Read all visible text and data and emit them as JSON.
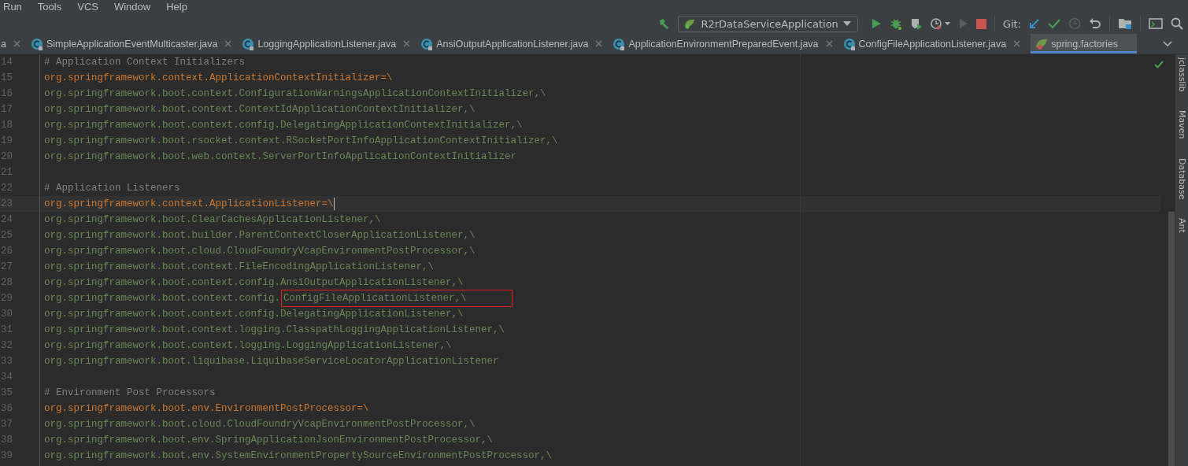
{
  "menu": [
    "Run",
    "Tools",
    "VCS",
    "Window",
    "Help"
  ],
  "toolbar": {
    "run_config": "R2rDataServiceApplication",
    "git_label": "Git:"
  },
  "tabs": [
    {
      "label": "a",
      "selected": false
    },
    {
      "label": "SimpleApplicationEventMulticaster.java",
      "kind": "java",
      "selected": false
    },
    {
      "label": "LoggingApplicationListener.java",
      "kind": "java",
      "selected": false
    },
    {
      "label": "AnsiOutputApplicationListener.java",
      "kind": "java",
      "selected": false
    },
    {
      "label": "ApplicationEnvironmentPreparedEvent.java",
      "kind": "java",
      "selected": false
    },
    {
      "label": "ConfigFileApplicationListener.java",
      "kind": "java",
      "selected": false
    },
    {
      "label": "spring.factories",
      "kind": "spring",
      "selected": true
    }
  ],
  "lines": [
    {
      "number": "14",
      "kind": "comment",
      "text": "# Application Context Initializers"
    },
    {
      "number": "15",
      "kind": "key",
      "text": "org.springframework.context.ApplicationContextInitializer=\\"
    },
    {
      "number": "16",
      "kind": "value",
      "text": "org.springframework.boot.context.ConfigurationWarningsApplicationContextInitializer,\\"
    },
    {
      "number": "17",
      "kind": "value",
      "text": "org.springframework.boot.context.ContextIdApplicationContextInitializer,\\"
    },
    {
      "number": "18",
      "kind": "value",
      "text": "org.springframework.boot.context.config.DelegatingApplicationContextInitializer,\\"
    },
    {
      "number": "19",
      "kind": "value",
      "text": "org.springframework.boot.rsocket.context.RSocketPortInfoApplicationContextInitializer,\\"
    },
    {
      "number": "20",
      "kind": "value",
      "text": "org.springframework.boot.web.context.ServerPortInfoApplicationContextInitializer"
    },
    {
      "number": "21",
      "kind": "blank"
    },
    {
      "number": "22",
      "kind": "comment",
      "text": "# Application Listeners"
    },
    {
      "number": "23",
      "kind": "key",
      "text": "org.springframework.context.ApplicationListener=\\",
      "current": true
    },
    {
      "number": "24",
      "kind": "value",
      "text": "org.springframework.boot.ClearCachesApplicationListener,\\"
    },
    {
      "number": "25",
      "kind": "value",
      "text": "org.springframework.boot.builder.ParentContextCloserApplicationListener,\\"
    },
    {
      "number": "26",
      "kind": "value",
      "text": "org.springframework.boot.cloud.CloudFoundryVcapEnvironmentPostProcessor,\\"
    },
    {
      "number": "27",
      "kind": "value",
      "text": "org.springframework.boot.context.FileEncodingApplicationListener,\\"
    },
    {
      "number": "28",
      "kind": "value",
      "text": "org.springframework.boot.context.config.AnsiOutputApplicationListener,\\"
    },
    {
      "number": "29",
      "kind": "value",
      "text": "org.springframework.boot.context.config.",
      "boxed_text": "ConfigFileApplicationListener,\\"
    },
    {
      "number": "30",
      "kind": "value",
      "text": "org.springframework.boot.context.config.DelegatingApplicationListener,\\"
    },
    {
      "number": "31",
      "kind": "value",
      "text": "org.springframework.boot.context.logging.ClasspathLoggingApplicationListener,\\"
    },
    {
      "number": "32",
      "kind": "value",
      "text": "org.springframework.boot.context.logging.LoggingApplicationListener,\\"
    },
    {
      "number": "33",
      "kind": "value",
      "text": "org.springframework.boot.liquibase.LiquibaseServiceLocatorApplicationListener"
    },
    {
      "number": "34",
      "kind": "blank"
    },
    {
      "number": "35",
      "kind": "comment",
      "text": "# Environment Post Processors"
    },
    {
      "number": "36",
      "kind": "key",
      "text": "org.springframework.boot.env.EnvironmentPostProcessor=\\"
    },
    {
      "number": "37",
      "kind": "value",
      "text": "org.springframework.boot.cloud.CloudFoundryVcapEnvironmentPostProcessor,\\"
    },
    {
      "number": "38",
      "kind": "value",
      "text": "org.springframework.boot.env.SpringApplicationJsonEnvironmentPostProcessor,\\"
    },
    {
      "number": "39",
      "kind": "value",
      "text": "org.springframework.boot.env.SystemEnvironmentPropertySourceEnvironmentPostProcessor,\\"
    }
  ],
  "side_tools": [
    "jclasslib",
    "Maven",
    "Database",
    "Ant"
  ]
}
